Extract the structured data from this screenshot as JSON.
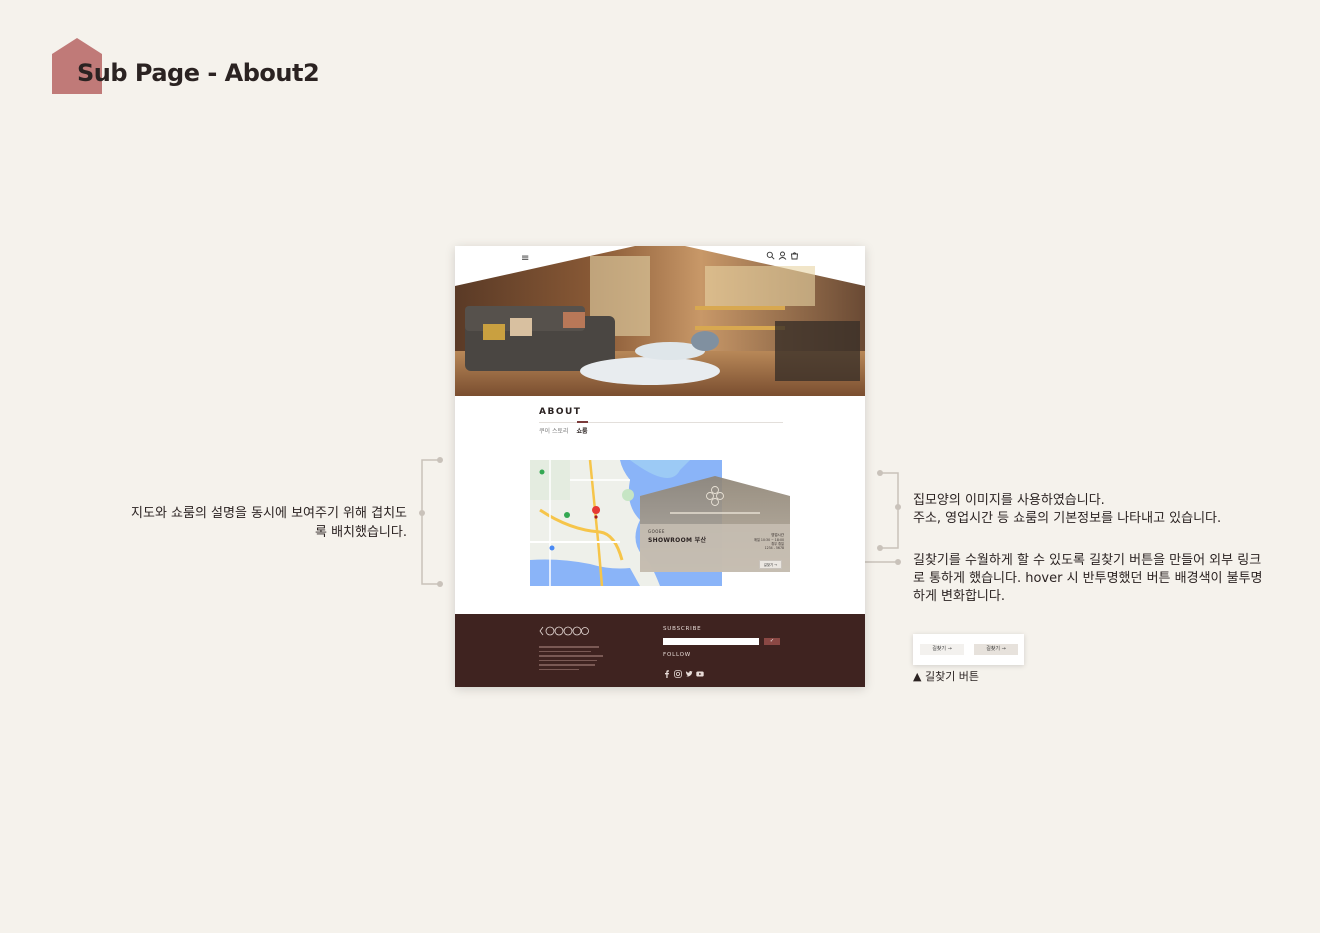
{
  "title": "Sub Page - About2",
  "colors": {
    "accent": "#c07a78",
    "footer": "#3f2320",
    "background": "#f5f2ec"
  },
  "mockup": {
    "nav": {
      "menu_icon": "hamburger-icon",
      "icons": [
        "search-icon",
        "user-icon",
        "cart-icon"
      ]
    },
    "about": {
      "title": "ABOUT",
      "tabs": [
        {
          "label": "쿠이 스토리",
          "active": false
        },
        {
          "label": "쇼룸",
          "active": true
        }
      ]
    },
    "showroom": {
      "brand": "GOOEE",
      "name": "SHOWROOM 부산",
      "hours_label": "영업시간",
      "hours_value": "매일 10:30 ~ 18:00",
      "closed_label": "휴무 휴일",
      "phone": "1234 - 5678",
      "button": "길찾기 →"
    },
    "footer": {
      "subscribe_label": "SUBSCRIBE",
      "submit_icon": "check-icon",
      "follow_label": "FOLLOW",
      "socials": [
        "facebook-icon",
        "instagram-icon",
        "twitter-icon",
        "youtube-icon"
      ]
    }
  },
  "annotations": {
    "left": "지도와 쇼룸의 설명을 동시에 보여주기 위해 겹치도록 배치했습니다.",
    "right1_line1": "집모양의 이미지를 사용하였습니다.",
    "right1_line2": "주소, 영업시간 등 쇼룸의 기본정보를 나타내고 있습니다.",
    "right2": "길찾기를 수월하게 할 수 있도록 길찾기 버튼을 만들어 외부 링크로 통하게 했습니다. hover 시 반투명했던 버튼 배경색이 불투명하게 변화합니다.",
    "button_demo": {
      "normal": "길찾기 →",
      "hover": "길찾기 →"
    },
    "button_caption": "▲ 길찾기 버튼"
  }
}
